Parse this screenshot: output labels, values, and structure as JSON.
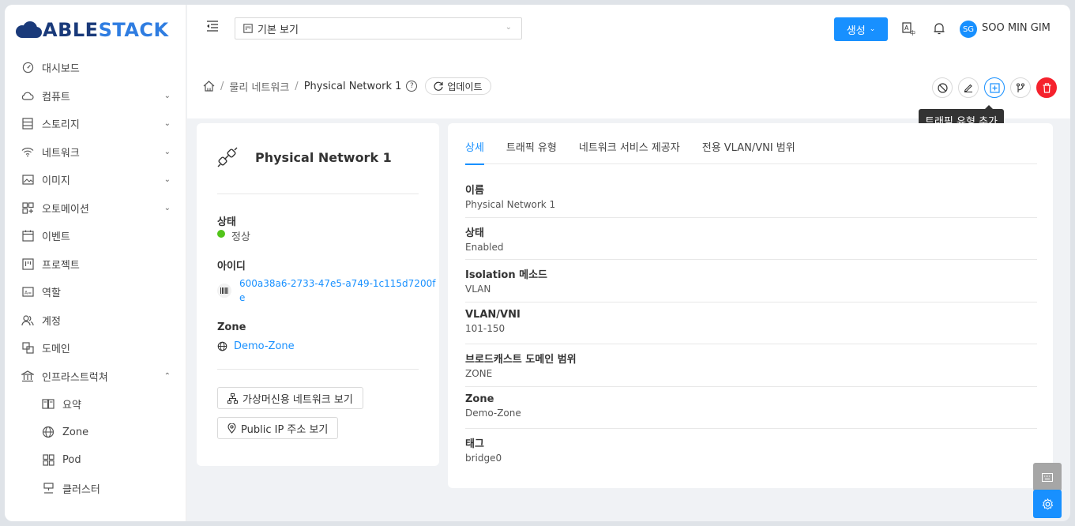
{
  "app": {
    "logo_part1": "ABLE",
    "logo_part2": "STACK"
  },
  "sidebar": {
    "items": [
      {
        "label": "대시보드",
        "icon": "dashboard-icon"
      },
      {
        "label": "컴퓨트",
        "icon": "cloud-icon",
        "expandable": true
      },
      {
        "label": "스토리지",
        "icon": "storage-icon",
        "expandable": true
      },
      {
        "label": "네트워크",
        "icon": "wifi-icon",
        "expandable": true
      },
      {
        "label": "이미지",
        "icon": "picture-icon",
        "expandable": true
      },
      {
        "label": "오토메이션",
        "icon": "automation-icon",
        "expandable": true
      },
      {
        "label": "이벤트",
        "icon": "schedule-icon"
      },
      {
        "label": "프로젝트",
        "icon": "project-icon"
      },
      {
        "label": "역할",
        "icon": "idcard-icon"
      },
      {
        "label": "계정",
        "icon": "team-icon"
      },
      {
        "label": "도메인",
        "icon": "block-icon"
      },
      {
        "label": "인프라스트럭쳐",
        "icon": "bank-icon",
        "expanded": true
      }
    ],
    "sub_items": [
      {
        "label": "요약",
        "icon": "read-icon"
      },
      {
        "label": "Zone",
        "icon": "globe-icon"
      },
      {
        "label": "Pod",
        "icon": "appstore-icon"
      },
      {
        "label": "클러스터",
        "icon": "cluster-icon"
      }
    ]
  },
  "header": {
    "view_select": "기본 보기",
    "create_label": "생성",
    "avatar_initials": "SG",
    "username": "SOO MIN GIM"
  },
  "breadcrumb": {
    "parent": "물리 네트워크",
    "current": "Physical Network 1",
    "separator": "/",
    "update_label": "업데이트"
  },
  "tooltip": "트래픽 유형 추가",
  "summary": {
    "title": "Physical Network 1",
    "state_label": "상태",
    "state_value": "정상",
    "id_label": "아이디",
    "id_line1": "600a38a6-2733-47e5-a749-1c115d7200f",
    "id_line2": "e",
    "zone_label": "Zone",
    "zone_value": "Demo-Zone",
    "btn_vm_network": "가상머신용 네트워크 보기",
    "btn_public_ip": "Public IP 주소 보기"
  },
  "tabs": [
    "상세",
    "트래픽 유형",
    "네트워크 서비스 제공자",
    "전용 VLAN/VNI 범위"
  ],
  "details": [
    {
      "key": "이름",
      "value": "Physical Network 1"
    },
    {
      "key": "상태",
      "value": "Enabled"
    },
    {
      "key": "Isolation 메소드",
      "value": "VLAN"
    },
    {
      "key": "VLAN/VNI",
      "value": "101-150"
    },
    {
      "key": "브로드캐스트 도메인 범위",
      "value": "ZONE"
    },
    {
      "key": "Zone",
      "value": "Demo-Zone"
    },
    {
      "key": "태그",
      "value": "bridge0"
    }
  ],
  "colors": {
    "primary": "#1890ff",
    "danger": "#f5222d",
    "success": "#52c41a",
    "logo_dark": "#1a3a7a"
  }
}
